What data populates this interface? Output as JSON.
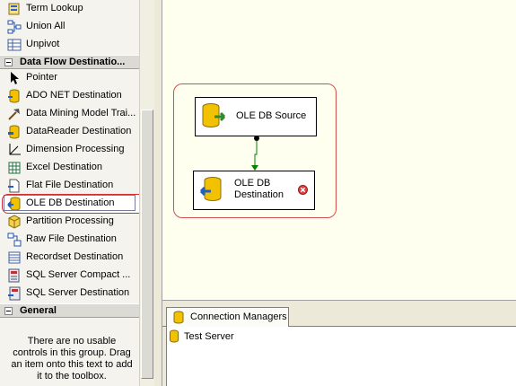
{
  "toolbox": {
    "items_top": [
      {
        "label": "Term Lookup",
        "icon": "term-lookup-icon"
      },
      {
        "label": "Union All",
        "icon": "union-all-icon"
      },
      {
        "label": "Unpivot",
        "icon": "unpivot-icon"
      }
    ],
    "category_destinations": "Data Flow Destinatio...",
    "items_destinations": [
      {
        "label": "Pointer",
        "icon": "pointer-icon"
      },
      {
        "label": "ADO NET Destination",
        "icon": "ado-net-destination-icon"
      },
      {
        "label": "Data Mining Model Trai...",
        "icon": "data-mining-icon"
      },
      {
        "label": "DataReader Destination",
        "icon": "datareader-destination-icon"
      },
      {
        "label": "Dimension Processing",
        "icon": "dimension-processing-icon"
      },
      {
        "label": "Excel Destination",
        "icon": "excel-destination-icon"
      },
      {
        "label": "Flat File Destination",
        "icon": "flat-file-destination-icon"
      },
      {
        "label": "OLE DB Destination",
        "icon": "ole-db-destination-icon",
        "selected": true
      },
      {
        "label": "Partition Processing",
        "icon": "partition-processing-icon"
      },
      {
        "label": "Raw File Destination",
        "icon": "raw-file-destination-icon"
      },
      {
        "label": "Recordset Destination",
        "icon": "recordset-destination-icon"
      },
      {
        "label": "SQL Server Compact ...",
        "icon": "sql-server-compact-icon"
      },
      {
        "label": "SQL Server Destination",
        "icon": "sql-server-destination-icon"
      }
    ],
    "category_general": "General",
    "general_empty_text": "There are no usable controls in this group. Drag an item onto this text to add it to the toolbox."
  },
  "canvas": {
    "source_label": "OLE DB Source",
    "destination_label": "OLE DB Destination",
    "destination_label_line1": "OLE DB",
    "destination_label_line2": "Destination"
  },
  "connections": {
    "tab_label": "Connection Managers",
    "items": [
      "Test Server"
    ]
  },
  "colors": {
    "highlight": "#d03030",
    "path": "#008000",
    "error": "#e04040"
  }
}
